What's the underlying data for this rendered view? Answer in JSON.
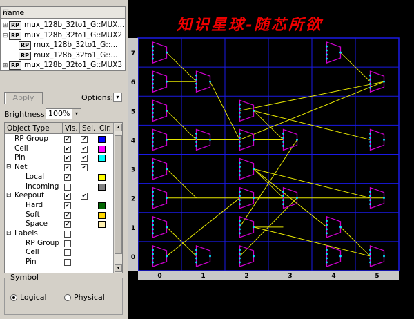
{
  "header": {
    "column": "name"
  },
  "tree": [
    {
      "tag": "RP",
      "label": "mux_128b_32to1_G::MUX...",
      "indent": 0,
      "exp": "+"
    },
    {
      "tag": "RP",
      "label": "mux_128b_32to1_G::MUX2",
      "indent": 0,
      "exp": "-"
    },
    {
      "tag": "RP",
      "label": "mux_128b_32to1_G::...",
      "indent": 1,
      "exp": ""
    },
    {
      "tag": "RP",
      "label": "mux_128b_32to1_G::...",
      "indent": 1,
      "exp": ""
    },
    {
      "tag": "RP",
      "label": "mux_128b_32to1_G::MUX3",
      "indent": 0,
      "exp": "+"
    }
  ],
  "controls": {
    "apply": "Apply",
    "options": "Options:",
    "brightness_label": "Brightness:",
    "brightness_value": "100%"
  },
  "table": {
    "headers": [
      "Object Type",
      "Vis.",
      "Sel.",
      "Clr."
    ],
    "rows": [
      {
        "name": "RP Group",
        "exp": "",
        "ind": 1,
        "vis": true,
        "sel": true,
        "clr": "#0000ff"
      },
      {
        "name": "Cell",
        "exp": "",
        "ind": 1,
        "vis": true,
        "sel": true,
        "clr": "#ff00ff"
      },
      {
        "name": "Pin",
        "exp": "",
        "ind": 1,
        "vis": true,
        "sel": true,
        "clr": "#00ffff"
      },
      {
        "name": "Net",
        "exp": "-",
        "ind": 0,
        "vis": true,
        "sel": true,
        "clr": ""
      },
      {
        "name": "Local",
        "exp": "",
        "ind": 2,
        "vis": true,
        "sel": null,
        "clr": "#ffff00"
      },
      {
        "name": "Incoming",
        "exp": "",
        "ind": 2,
        "vis": false,
        "sel": null,
        "clr": "#808080"
      },
      {
        "name": "Keepout",
        "exp": "-",
        "ind": 0,
        "vis": true,
        "sel": true,
        "clr": ""
      },
      {
        "name": "Hard",
        "exp": "",
        "ind": 2,
        "vis": true,
        "sel": null,
        "clr": "#006400"
      },
      {
        "name": "Soft",
        "exp": "",
        "ind": 2,
        "vis": true,
        "sel": null,
        "clr": "#ffd700"
      },
      {
        "name": "Space",
        "exp": "",
        "ind": 2,
        "vis": true,
        "sel": null,
        "clr": "#fff0b0"
      },
      {
        "name": "Labels",
        "exp": "-",
        "ind": 0,
        "vis": false,
        "sel": null,
        "clr": ""
      },
      {
        "name": "RP Group",
        "exp": "",
        "ind": 2,
        "vis": false,
        "sel": null,
        "clr": ""
      },
      {
        "name": "Cell",
        "exp": "",
        "ind": 2,
        "vis": false,
        "sel": null,
        "clr": ""
      },
      {
        "name": "Pin",
        "exp": "",
        "ind": 2,
        "vis": false,
        "sel": null,
        "clr": ""
      }
    ]
  },
  "symbol": {
    "group_label": "Symbol",
    "logical": "Logical",
    "physical": "Physical",
    "selected": "Logical"
  },
  "canvas": {
    "title": "知识星球-随芯所欲",
    "row_labels": [
      "7",
      "6",
      "5",
      "4",
      "3",
      "2",
      "1",
      "0"
    ],
    "col_labels": [
      "0",
      "1",
      "2",
      "3",
      "4",
      "5"
    ],
    "colors": {
      "grid": "#1a1ae6",
      "cell": "#cc00cc",
      "pin": "#00e5ff",
      "net": "#e6e600"
    }
  }
}
